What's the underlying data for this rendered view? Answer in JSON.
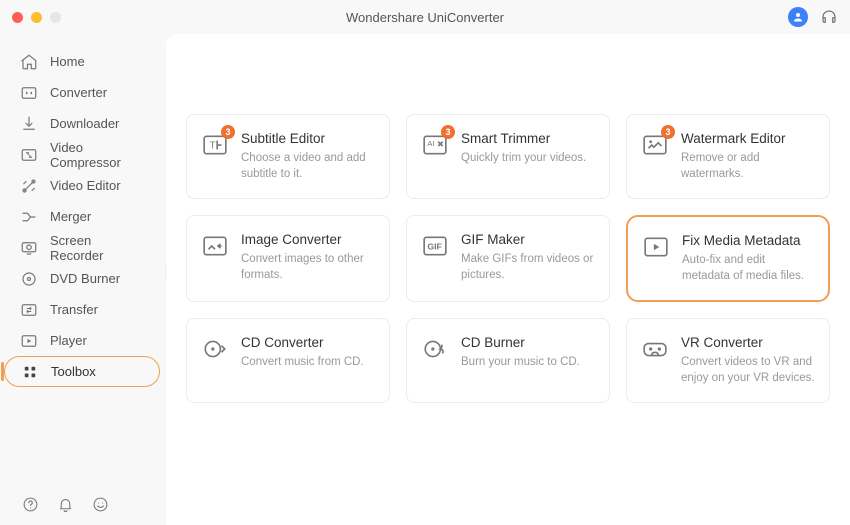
{
  "app_title": "Wondershare UniConverter",
  "sidebar": {
    "items": [
      {
        "label": "Home",
        "icon": "home"
      },
      {
        "label": "Converter",
        "icon": "converter"
      },
      {
        "label": "Downloader",
        "icon": "download"
      },
      {
        "label": "Video Compressor",
        "icon": "compress"
      },
      {
        "label": "Video Editor",
        "icon": "editor"
      },
      {
        "label": "Merger",
        "icon": "merger"
      },
      {
        "label": "Screen Recorder",
        "icon": "recorder"
      },
      {
        "label": "DVD Burner",
        "icon": "dvd"
      },
      {
        "label": "Transfer",
        "icon": "transfer"
      },
      {
        "label": "Player",
        "icon": "player"
      },
      {
        "label": "Toolbox",
        "icon": "toolbox"
      }
    ],
    "active_index": 10
  },
  "tools": [
    {
      "title": "Subtitle Editor",
      "desc": "Choose a video and add subtitle to it.",
      "icon": "subtitle",
      "badge": "3"
    },
    {
      "title": "Smart Trimmer",
      "desc": "Quickly trim your videos.",
      "icon": "trimmer",
      "badge": "3"
    },
    {
      "title": "Watermark Editor",
      "desc": "Remove or add watermarks.",
      "icon": "watermark",
      "badge": "3"
    },
    {
      "title": "Image Converter",
      "desc": "Convert images to other formats.",
      "icon": "imgconv",
      "badge": null
    },
    {
      "title": "GIF Maker",
      "desc": "Make GIFs from videos or pictures.",
      "icon": "gif",
      "badge": null
    },
    {
      "title": "Fix Media Metadata",
      "desc": "Auto-fix and edit metadata of media files.",
      "icon": "metadata",
      "badge": null,
      "highlight": true
    },
    {
      "title": "CD Converter",
      "desc": "Convert music from CD.",
      "icon": "cdconv",
      "badge": null
    },
    {
      "title": "CD Burner",
      "desc": "Burn your music to CD.",
      "icon": "cdburn",
      "badge": null
    },
    {
      "title": "VR Converter",
      "desc": "Convert videos to VR and enjoy on your VR devices.",
      "icon": "vr",
      "badge": null
    }
  ],
  "colors": {
    "accent": "#f0a050"
  }
}
